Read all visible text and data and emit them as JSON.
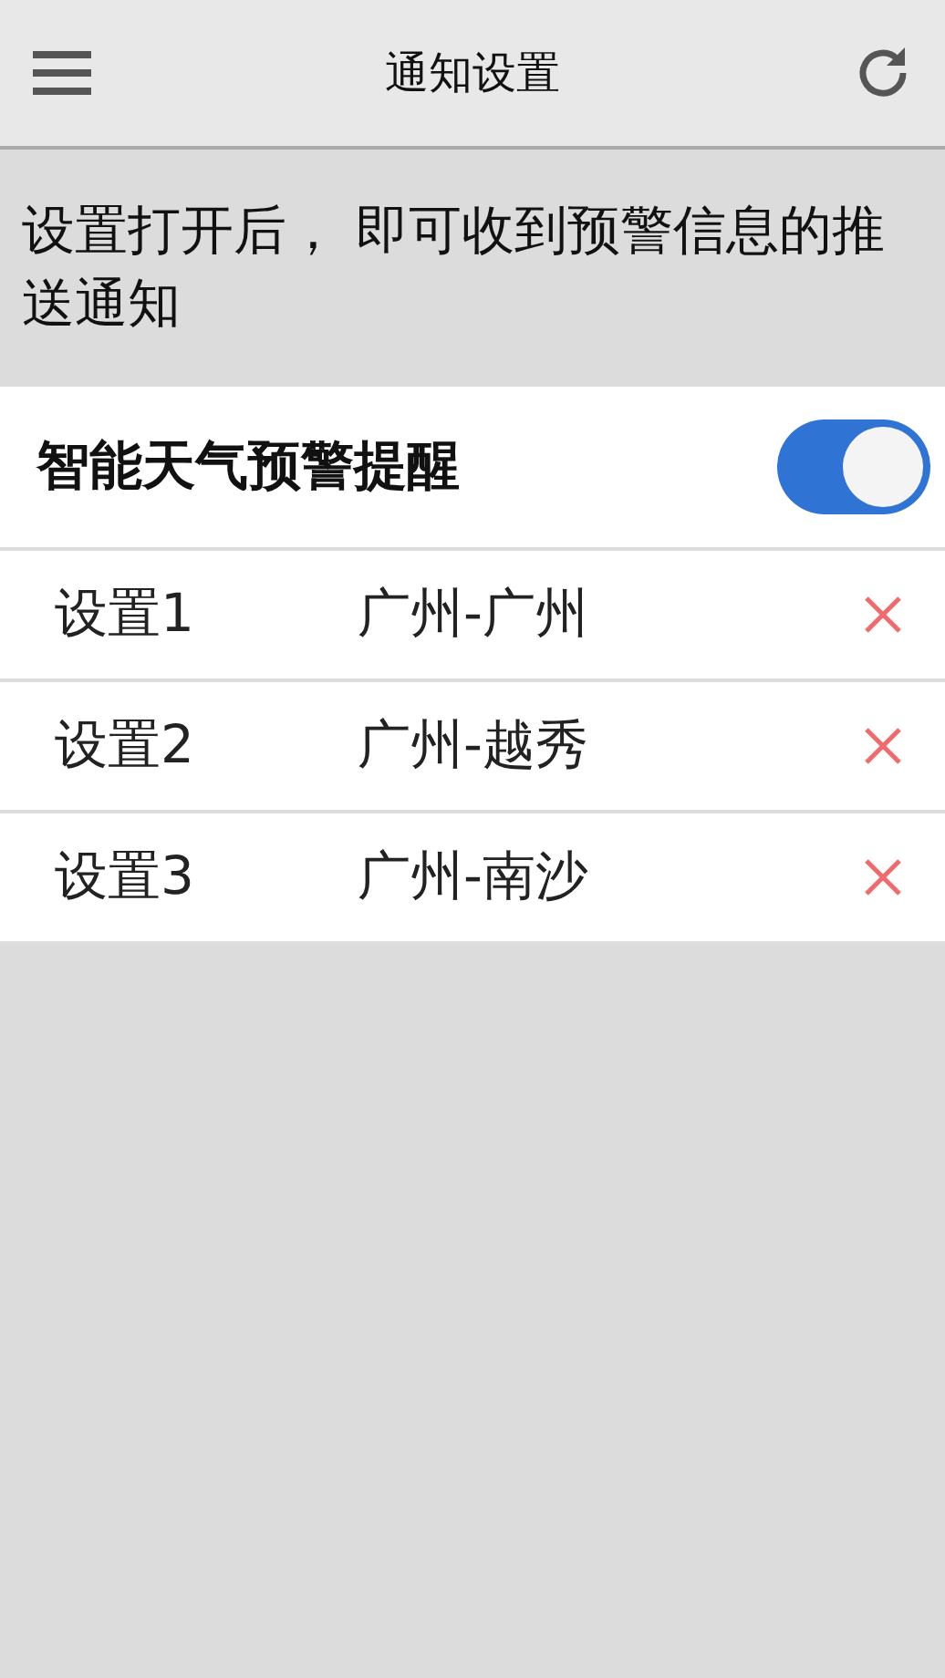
{
  "header": {
    "title": "通知设置"
  },
  "notice": "设置打开后， 即可收到预警信息的推送通知",
  "alert_toggle": {
    "label": "智能天气预警提醒",
    "on": true
  },
  "settings": [
    {
      "name": "设置1",
      "location": "广州-广州"
    },
    {
      "name": "设置2",
      "location": "广州-越秀"
    },
    {
      "name": "设置3",
      "location": "广州-南沙"
    }
  ]
}
